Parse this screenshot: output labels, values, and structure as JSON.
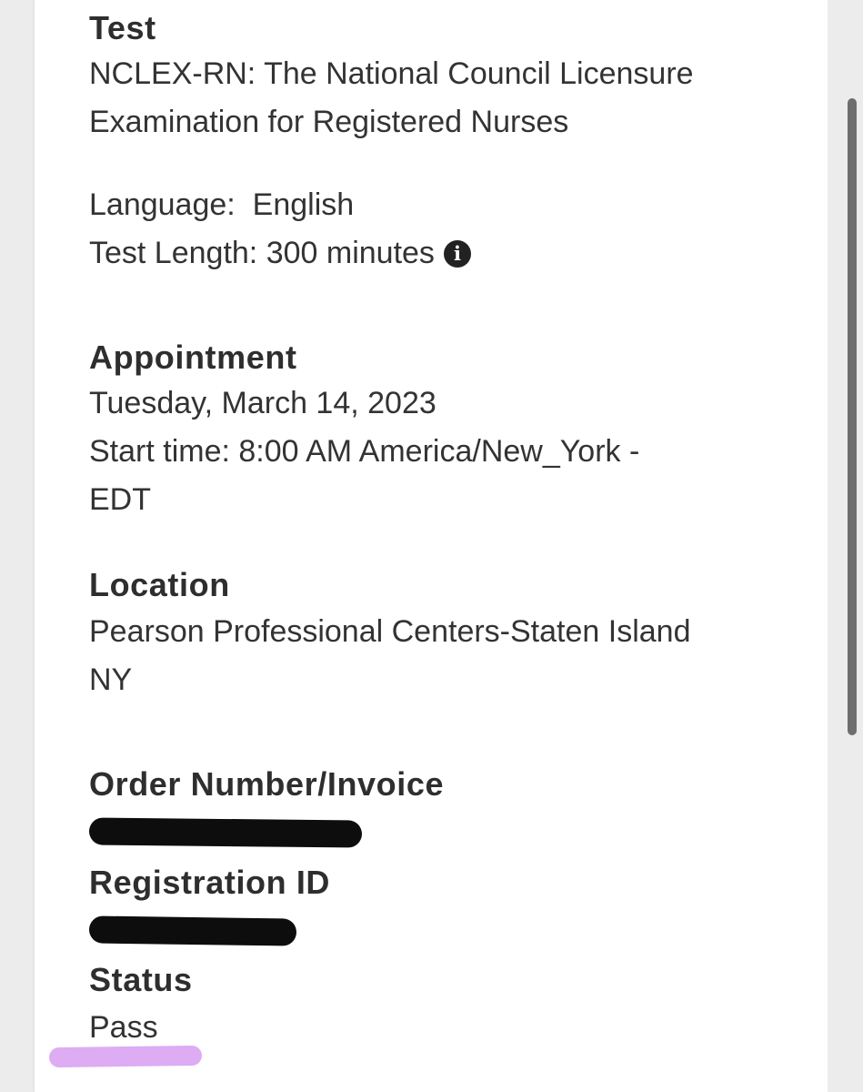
{
  "test": {
    "label": "Test",
    "name_line1": "NCLEX-RN: The National Council Licensure",
    "name_line2": "Examination for Registered Nurses",
    "language_label": "Language:",
    "language_value": "English",
    "length_label": "Test Length:",
    "length_value": "300 minutes",
    "info_icon": "info-circle-icon",
    "info_glyph": "i"
  },
  "appointment": {
    "label": "Appointment",
    "date": "Tuesday, March 14, 2023",
    "start_line1": "Start time: 8:00 AM America/New_York -",
    "start_line2": "EDT"
  },
  "location": {
    "label": "Location",
    "line1": "Pearson Professional Centers-Staten Island",
    "line2": "NY"
  },
  "order": {
    "label": "Order Number/Invoice"
  },
  "registration": {
    "label": "Registration ID"
  },
  "status": {
    "label": "Status",
    "value": "Pass"
  },
  "colors": {
    "highlight": "#d9a3f2",
    "redaction": "#0d0d0d"
  }
}
